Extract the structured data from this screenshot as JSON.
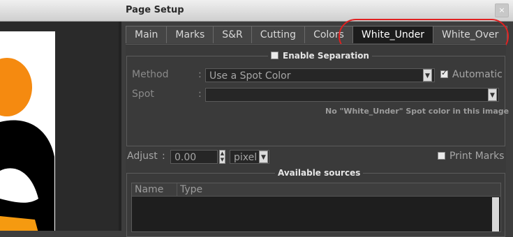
{
  "window": {
    "title": "Page Setup",
    "close_glyph": "×"
  },
  "tabs": [
    {
      "label": "Main"
    },
    {
      "label": "Marks"
    },
    {
      "label": "S&R"
    },
    {
      "label": "Cutting"
    },
    {
      "label": "Colors"
    },
    {
      "label": "White_Under",
      "active": true
    },
    {
      "label": "White_Over"
    }
  ],
  "separation": {
    "enable_label": "Enable Separation",
    "method_label": "Method",
    "method_value": "Use a Spot Color",
    "automatic_label": "Automatic",
    "automatic_checked": true,
    "spot_label": "Spot",
    "spot_value": "",
    "message": "No \"White_Under\" Spot color in this image",
    "colon": ":"
  },
  "adjust": {
    "label": "Adjust",
    "colon": ":",
    "value": "0.00",
    "unit": "pixel",
    "print_marks_label": "Print Marks"
  },
  "sources": {
    "legend": "Available sources",
    "columns": [
      "Name",
      "Type"
    ]
  },
  "icons": {
    "dropdown": "chevron-down-icon",
    "spinner": "spinner-arrows-icon"
  },
  "colors": {
    "highlight": "#e02020",
    "active_tab": "#1c1c1c"
  }
}
